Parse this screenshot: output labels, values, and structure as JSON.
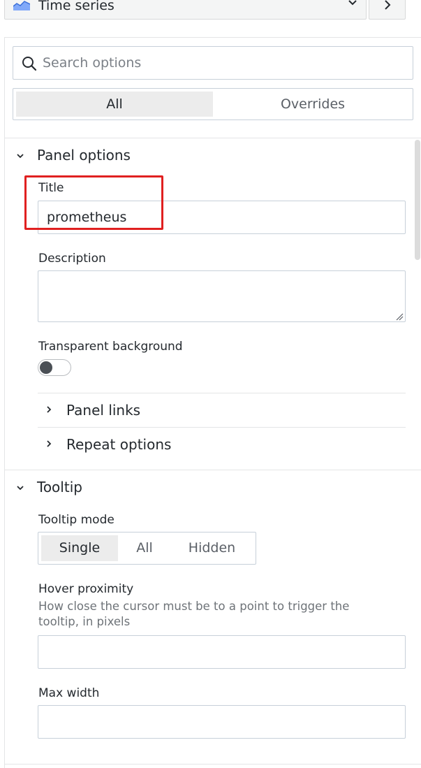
{
  "visualization_picker": {
    "label": "Time series",
    "icon": "time-series-chart-icon",
    "dropdown_icon": "chevron-down-icon",
    "collapse_icon": "chevron-right-icon"
  },
  "search": {
    "placeholder": "Search options",
    "value": "",
    "icon": "search-icon"
  },
  "option_tabs": [
    {
      "label": "All",
      "selected": true
    },
    {
      "label": "Overrides",
      "selected": false
    }
  ],
  "panel_options": {
    "header": "Panel options",
    "expanded": true,
    "title_label": "Title",
    "title_value": "prometheus",
    "description_label": "Description",
    "description_value": "",
    "transparent_label": "Transparent background",
    "transparent_on": false,
    "panel_links_label": "Panel links",
    "repeat_options_label": "Repeat options"
  },
  "tooltip": {
    "header": "Tooltip",
    "expanded": true,
    "mode_label": "Tooltip mode",
    "modes": [
      "Single",
      "All",
      "Hidden"
    ],
    "selected_mode": "Single",
    "hover_label": "Hover proximity",
    "hover_desc_line1": "How close the cursor must be to a point to trigger the",
    "hover_desc_line2": "tooltip, in pixels",
    "hover_value": "",
    "max_width_label": "Max width",
    "max_width_value": ""
  },
  "annotation": {
    "highlight_color": "#e02020"
  },
  "colors": {
    "border": "#c7d0d9",
    "selected_bg": "#ececec",
    "text": "#24292e",
    "muted": "#6e7378",
    "chart_icon_blue": "#5b8ff9"
  }
}
